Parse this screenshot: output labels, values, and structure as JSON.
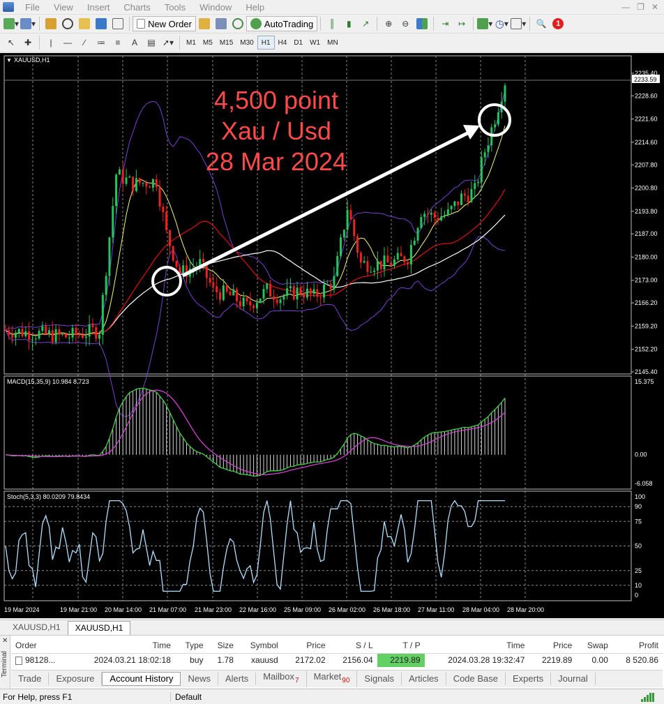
{
  "menu": {
    "items": [
      "File",
      "View",
      "Insert",
      "Charts",
      "Tools",
      "Window",
      "Help"
    ],
    "notification_count": "1"
  },
  "toolbar": {
    "new_order": "New Order",
    "autotrading": "AutoTrading",
    "timeframes": [
      "M1",
      "M5",
      "M15",
      "M30",
      "H1",
      "H4",
      "D1",
      "W1",
      "MN"
    ],
    "active_timeframe": "H1"
  },
  "chart": {
    "symbol_label": "XAUUSD,H1",
    "current_price": "2233.59",
    "price_ticks": [
      "2235.40",
      "2228.60",
      "2221.60",
      "2214.60",
      "2207.80",
      "2200.80",
      "2193.80",
      "2187.00",
      "2180.00",
      "2173.00",
      "2166.20",
      "2159.20",
      "2152.20",
      "2145.40"
    ],
    "macd_label": "MACD(15,35,9) 10.984 8.723",
    "macd_ticks": [
      "15.375",
      "0.00",
      "-6.058"
    ],
    "stoch_label": "Stoch(5,3,3) 80.0209 79.8434",
    "stoch_ticks": [
      "100",
      "90",
      "75",
      "50",
      "25",
      "10",
      "0"
    ],
    "time_labels": [
      "19 Mar 2024",
      "19 Mar 21:00",
      "20 Mar 14:00",
      "21 Mar 07:00",
      "21 Mar 23:00",
      "22 Mar 16:00",
      "25 Mar 09:00",
      "26 Mar 02:00",
      "26 Mar 18:00",
      "27 Mar 11:00",
      "28 Mar 04:00",
      "28 Mar 20:00"
    ],
    "annotation": [
      "4,500 point",
      "Xau / Usd",
      "28 Mar 2024"
    ],
    "colors": {
      "bull": "#22c55e",
      "bear": "#ef2020",
      "ma_red": "#e01010",
      "ma_white": "#ffffff",
      "ma_yellow": "#f5f57a",
      "bands": "#7a3fd0",
      "macd_signal": "#d040d0",
      "macd_main": "#40d040",
      "stoch": "#b0e0ff",
      "annotation": "#ff4040"
    }
  },
  "chart_tabs": [
    "XAUUSD,H1",
    "XAUUSD,H1"
  ],
  "terminal": {
    "side_label": "Terminal",
    "headers": [
      "Order",
      "Time",
      "Type",
      "Size",
      "Symbol",
      "Price",
      "S / L",
      "T / P",
      "Time",
      "Price",
      "Swap",
      "Profit"
    ],
    "row": [
      "98128...",
      "2024.03.21 18:02:18",
      "buy",
      "1.78",
      "xauusd",
      "2172.02",
      "2156.04",
      "2219.89",
      "2024.03.28 19:32:47",
      "2219.89",
      "0.00",
      "8 520.86"
    ],
    "tabs": [
      "Trade",
      "Exposure",
      "Account History",
      "News",
      "Alerts",
      "Mailbox",
      "Market",
      "Signals",
      "Articles",
      "Code Base",
      "Experts",
      "Journal"
    ],
    "active_tab": "Account History",
    "mailbox_badge": "7",
    "market_badge": "90"
  },
  "status": {
    "help": "For Help, press F1",
    "profile": "Default"
  }
}
